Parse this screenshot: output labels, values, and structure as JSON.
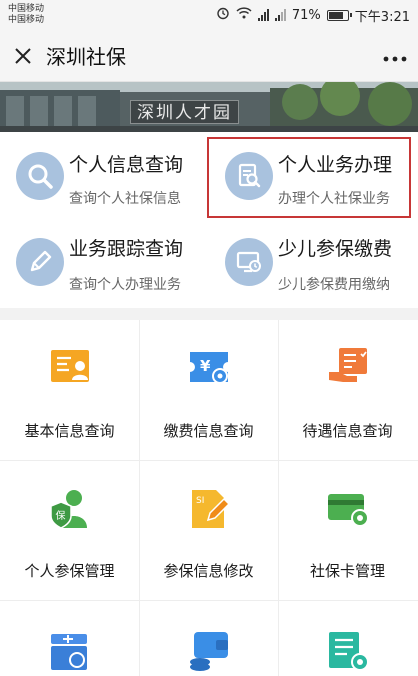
{
  "status_bar": {
    "carrier_1": "中国移动",
    "carrier_2": "中国移动",
    "battery_percent": "71%",
    "time": "下午3:21",
    "network_1": "4G",
    "network_2": "2G"
  },
  "nav": {
    "title": "深圳社保",
    "more_label": "···"
  },
  "banner": {
    "sign_text": "深圳人才园"
  },
  "quick_services": [
    {
      "title": "个人信息查询",
      "subtitle": "查询个人社保信息",
      "icon": "magnifier-icon"
    },
    {
      "title": "个人业务办理",
      "subtitle": "办理个人社保业务",
      "icon": "document-search-icon"
    },
    {
      "title": "业务跟踪查询",
      "subtitle": "查询个人办理业务",
      "icon": "pencil-icon"
    },
    {
      "title": "少儿参保缴费",
      "subtitle": "少儿参保费用缴纳",
      "icon": "monitor-clock-icon"
    }
  ],
  "grid": {
    "items": [
      {
        "label": "基本信息查询",
        "icon": "id-card-icon"
      },
      {
        "label": "缴费信息查询",
        "icon": "yuan-ticket-icon"
      },
      {
        "label": "待遇信息查询",
        "icon": "hand-document-icon"
      },
      {
        "label": "个人参保管理",
        "icon": "person-shield-icon"
      },
      {
        "label": "参保信息修改",
        "icon": "document-edit-icon"
      },
      {
        "label": "社保卡管理",
        "icon": "card-gear-icon"
      },
      {
        "label": "",
        "icon": "box-refresh-icon"
      },
      {
        "label": "",
        "icon": "wallet-coins-icon"
      },
      {
        "label": "",
        "icon": "list-gear-icon"
      }
    ]
  },
  "colors": {
    "quick_icon_bg": "#a9c2de",
    "highlight_border": "#c73636",
    "orange": "#f5a623",
    "blue": "#3a8ee6",
    "green": "#4caf50",
    "teal": "#2ab8a0"
  }
}
